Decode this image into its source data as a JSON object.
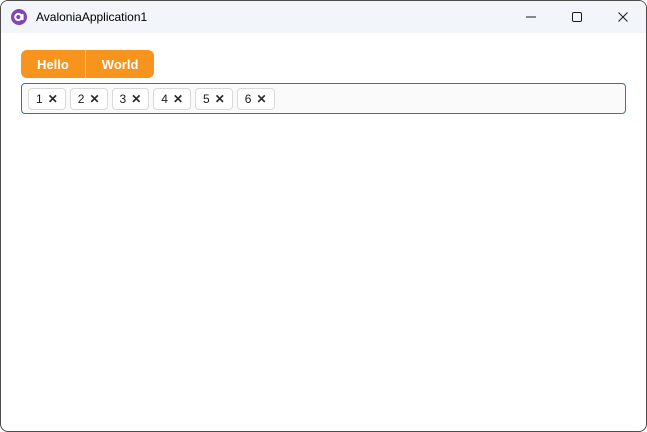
{
  "titlebar": {
    "app_title": "AvaloniaApplication1",
    "icons": {
      "app": "avalonia-logo",
      "minimize": "minimize",
      "maximize": "maximize",
      "close": "close"
    }
  },
  "tabstrip": {
    "accent_color": "#F7941E",
    "tabs": [
      {
        "label": "Hello"
      },
      {
        "label": "World"
      }
    ]
  },
  "chip_input": {
    "border_color": "#3273B8",
    "background_color": "#fafafa",
    "remove_icon": "✕",
    "chips": [
      {
        "label": "1"
      },
      {
        "label": "2"
      },
      {
        "label": "3"
      },
      {
        "label": "4"
      },
      {
        "label": "5"
      },
      {
        "label": "6"
      }
    ]
  }
}
